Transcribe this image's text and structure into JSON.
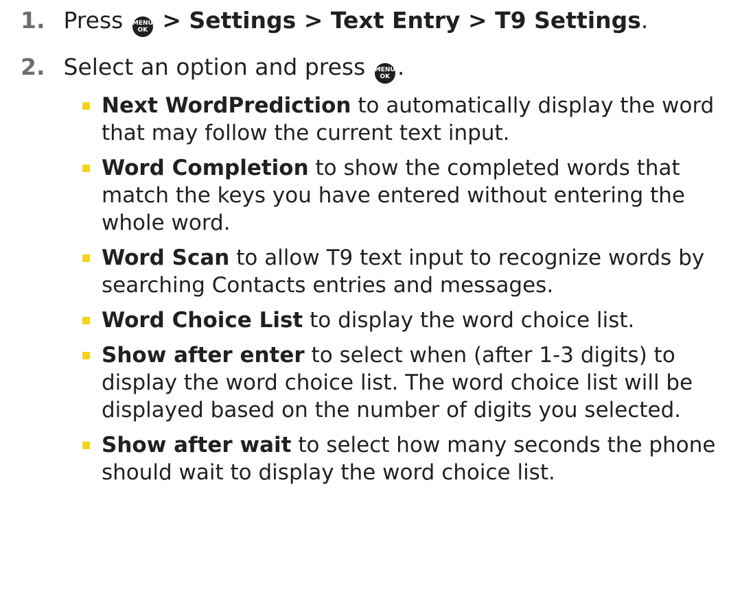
{
  "steps": [
    {
      "number": "1.",
      "prefix": "Press",
      "key_label_top": "MENU",
      "key_label_bottom": "OK",
      "path": "> Settings > Text Entry > T9 Settings",
      "suffix": "."
    },
    {
      "number": "2.",
      "prefix": "Select an option and press",
      "key_label_top": "MENU",
      "key_label_bottom": "OK",
      "suffix": "."
    }
  ],
  "options": [
    {
      "term": "Next WordPrediction",
      "text": " to automatically display the word that may follow the current text input."
    },
    {
      "term": "Word Completion",
      "text": " to show the completed words that match the keys you have entered without entering the whole word."
    },
    {
      "term": "Word Scan",
      "text": " to allow T9 text input to recognize words by searching Contacts entries and messages."
    },
    {
      "term": "Word Choice List",
      "text": " to display the word choice list."
    },
    {
      "term": "Show after enter",
      "text": " to select when (after 1-3 digits) to display the word choice list. The word choice list will be displayed based on the number of digits you selected."
    },
    {
      "term": "Show after wait",
      "text": " to select how many seconds the phone should wait to display the word choice list."
    }
  ],
  "colors": {
    "text": "#231f20",
    "step_number": "#6d6e71",
    "bullet": "#f5d418",
    "key_fill": "#231f20"
  }
}
